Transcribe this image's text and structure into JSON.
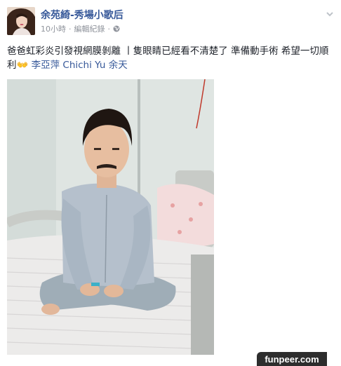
{
  "post": {
    "author": "余苑綺-秀場小歌后",
    "time": "10小時",
    "separator": "·",
    "edit_history": "編輯紀錄",
    "privacy_icon": "globe-icon",
    "menu_icon": "chevron-down-icon",
    "text_main": "爸爸虹彩炎引發視網膜剝離 丨隻眼睛已經看不清楚了 準備動手術 希望一切順利",
    "emoji": "👐",
    "tag_1": "李亞萍",
    "tag_2": "Chichi Yu 余天"
  },
  "watermark": {
    "text": "funpeer.com"
  },
  "colors": {
    "link": "#365899",
    "meta": "#90949c",
    "text": "#1d2129",
    "watermark_bg": "#2d2d2d"
  }
}
